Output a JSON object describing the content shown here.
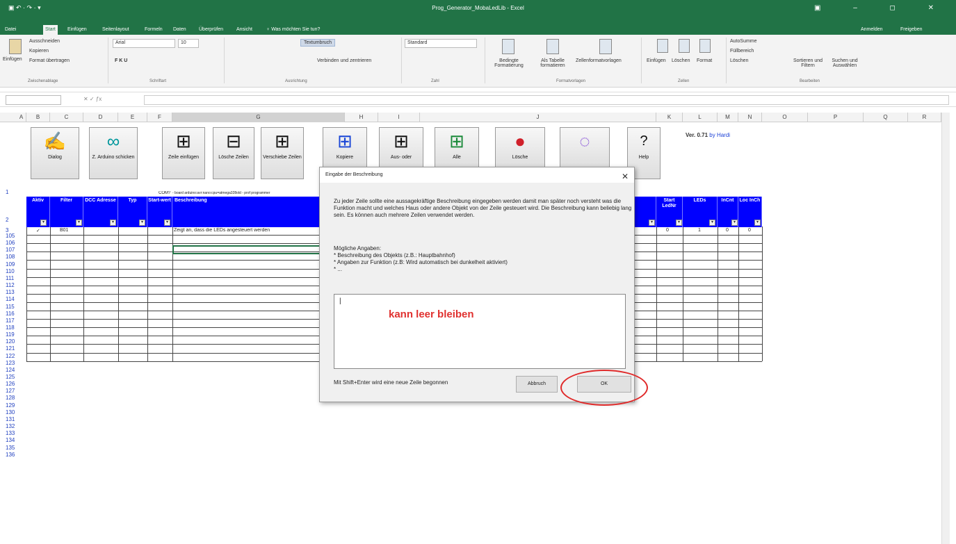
{
  "window": {
    "title": "Prog_Generator_MobaLedLib - Excel",
    "quick_access": "▣  ↶ · ↷ · ▾",
    "controls": "▣ – ◻ ✕"
  },
  "tabs": [
    "Datei",
    "Start",
    "Einfügen",
    "Seitenlayout",
    "Formeln",
    "Daten",
    "Überprüfen",
    "Ansicht",
    "♀ Was möchten Sie tun?"
  ],
  "account": {
    "login": "Anmelden",
    "share": "Freigeben"
  },
  "ribbon": {
    "clipboard": {
      "paste": "Einfügen",
      "cut": "Ausschneiden",
      "copy": "Kopieren",
      "format_painter": "Format übertragen",
      "group": "Zwischenablage"
    },
    "font": {
      "name": "Arial",
      "size": "10",
      "group": "Schriftart"
    },
    "alignment": {
      "wrap": "Textumbruch",
      "merge": "Verbinden und zentrieren",
      "group": "Ausrichtung"
    },
    "number": {
      "format": "Standard",
      "group": "Zahl"
    },
    "styles": {
      "conditional": "Bedingte Formatierung",
      "table": "Als Tabelle formatieren",
      "cell_styles": "Zellenformatvorlagen",
      "group": "Formatvorlagen"
    },
    "cells": {
      "insert": "Einfügen",
      "delete": "Löschen",
      "format": "Format",
      "group": "Zellen"
    },
    "editing": {
      "autosum": "AutoSumme",
      "fill": "Füllbereich",
      "clear": "Löschen",
      "sort": "Sortieren und Filtern",
      "find": "Suchen und Auswählen",
      "group": "Bearbeiten"
    }
  },
  "columns": [
    "A",
    "B",
    "C",
    "D",
    "E",
    "F",
    "G",
    "H",
    "I",
    "J",
    "K",
    "L",
    "M",
    "N",
    "O",
    "P",
    "Q",
    "R"
  ],
  "rows": [
    "1",
    "2",
    "3",
    "105",
    "106",
    "107",
    "108",
    "109",
    "110",
    "111",
    "112",
    "113",
    "114",
    "115",
    "116",
    "117",
    "118",
    "119",
    "120",
    "121",
    "122",
    "123",
    "124",
    "125",
    "126",
    "127",
    "128",
    "129",
    "130",
    "131",
    "132",
    "133",
    "134",
    "135",
    "136"
  ],
  "macro_buttons": [
    {
      "label": "Dialog",
      "icon": "person-reading-icon"
    },
    {
      "label": "Z. Arduino schicken",
      "icon": "arduino-icon"
    },
    {
      "label": "Zeile einfügen",
      "icon": "insert-row-icon"
    },
    {
      "label": "Lösche Zeilen",
      "icon": "delete-rows-icon"
    },
    {
      "label": "Verschiebe Zeilen",
      "icon": "move-rows-icon"
    },
    {
      "label": "Kopiere",
      "icon": "copy-rows-icon"
    },
    {
      "label": "Aus- oder",
      "icon": "hide-rows-icon"
    },
    {
      "label": "Alle",
      "icon": "show-all-icon"
    },
    {
      "label": "Lösche",
      "icon": "delete-new-icon"
    },
    {
      "label": "",
      "icon": "color-wheel-icon"
    },
    {
      "label": "Help",
      "icon": "help-figure-icon"
    }
  ],
  "version": {
    "text": "Ver. 0.71",
    "author": "by Hardi"
  },
  "row1_notes": {
    "com": "COM?",
    "board": "- board arduino:avr:nano:cpu=atmega328old - prof programmer"
  },
  "table_headers": [
    "Aktiv",
    "Filter",
    "DCC Adresse",
    "Typ",
    "Start-wert",
    "Beschreibung",
    "Start LedNr",
    "LEDs",
    "InCnt",
    "Loc InCh"
  ],
  "row3": {
    "aktiv": "✓",
    "filter": "B01",
    "beschreibung": "Zeigt an, dass die LEDs angesteuert werden",
    "start_led": "0",
    "leds": "1",
    "incnt": "0",
    "loc": "0"
  },
  "dialog": {
    "title": "Eingabe der Beschreibung",
    "close": "✕",
    "intro": "Zu jeder Zeile sollte eine aussagekräftige Beschreibung eingegeben werden damit man später noch versteht was die Funktion macht und welches Haus oder andere Objekt von der Zeile gesteuert wird. Die Beschreibung kann beliebig lang sein. Es können auch mehrere Zeilen verwendet werden.",
    "list_title": "Mögliche Angaben:",
    "list_items": [
      "* Beschreibung des Objekts (z.B.: Hauptbahnhof)",
      "* Angaben zur Funktion (z.B: Wird automatisch bei  dunkelheit aktiviert)",
      "* ..."
    ],
    "input_annotation": "kann leer bleiben",
    "hint": "Mit Shift+Enter wird eine neue Zeile begonnen",
    "cancel": "Abbruch",
    "ok": "OK"
  }
}
